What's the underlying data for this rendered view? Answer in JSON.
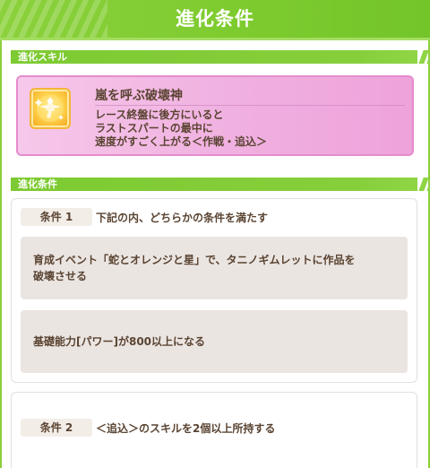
{
  "header": {
    "title": "進化条件"
  },
  "sections": {
    "skill": "進化スキル",
    "conditions": "進化条件"
  },
  "skill": {
    "icon": "runner-sparkle-icon",
    "name": "嵐を呼ぶ破壊神",
    "description": [
      "レース終盤に後方にいると",
      "ラストスパートの最中に",
      "速度がすごく上がる＜作戦・追込＞"
    ]
  },
  "conditions": [
    {
      "tag": "条件 1",
      "text": "下記の内、どちらかの条件を満たす",
      "options": [
        {
          "lines": [
            "育成イベント「蛇とオレンジと星」で、タニノギムレットに作品を",
            "破壊させる"
          ]
        },
        {
          "lines": [
            "基礎能力[パワー]が800以上になる"
          ]
        }
      ]
    },
    {
      "tag": "条件 2",
      "text": "＜追込＞のスキルを2個以上所持する"
    }
  ],
  "colors": {
    "accent_green": "#7ecb2f",
    "skill_pink": "#f0b0e0",
    "text_brown": "#5a4432",
    "option_bg": "#ebe5e2"
  }
}
